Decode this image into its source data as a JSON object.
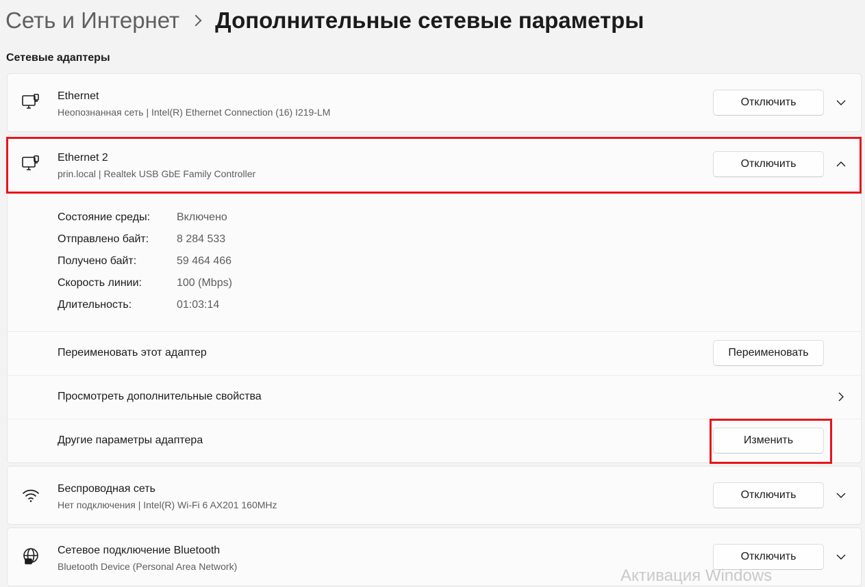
{
  "breadcrumb": {
    "parent": "Сеть и Интернет",
    "current": "Дополнительные сетевые параметры"
  },
  "section_title": "Сетевые адаптеры",
  "adapters": [
    {
      "name": "Ethernet",
      "subtitle": "Неопознанная сеть | Intel(R) Ethernet Connection (16) I219-LM",
      "button": "Отключить",
      "expanded": false,
      "icon": "ethernet-icon"
    },
    {
      "name": "Ethernet 2",
      "subtitle": "prin.local | Realtek USB GbE Family Controller",
      "button": "Отключить",
      "expanded": true,
      "icon": "ethernet-icon",
      "details": [
        {
          "label": "Состояние среды:",
          "value": "Включено"
        },
        {
          "label": "Отправлено байт:",
          "value": "8 284 533"
        },
        {
          "label": "Получено байт:",
          "value": "59 464 466"
        },
        {
          "label": "Скорость линии:",
          "value": "100 (Mbps)"
        },
        {
          "label": "Длительность:",
          "value": "01:03:14"
        }
      ],
      "actions": {
        "rename_label": "Переименовать этот адаптер",
        "rename_button": "Переименовать",
        "properties_label": "Просмотреть дополнительные свойства",
        "other_label": "Другие параметры адаптера",
        "other_button": "Изменить"
      }
    },
    {
      "name": "Беспроводная сеть",
      "subtitle": "Нет подключения | Intel(R) Wi-Fi 6 AX201 160MHz",
      "button": "Отключить",
      "expanded": false,
      "icon": "wifi-icon"
    },
    {
      "name": "Сетевое подключение Bluetooth",
      "subtitle": "Bluetooth Device (Personal Area Network)",
      "button": "Отключить",
      "expanded": false,
      "icon": "globe-network-icon"
    }
  ],
  "watermark": "Активация Windows",
  "colors": {
    "highlight": "#e8141a",
    "background": "#f3f3f3",
    "card": "#fbfbfb"
  }
}
